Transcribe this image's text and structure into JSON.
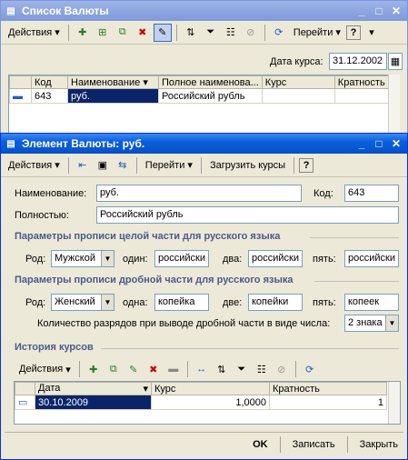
{
  "list_window": {
    "title": "Список Валюты",
    "toolbar": {
      "actions_label": "Действия",
      "goto_label": "Перейти",
      "help_label": "?"
    },
    "rate_date_label": "Дата курса:",
    "rate_date_value": "31.12.2002",
    "columns": [
      "Код",
      "Наименование",
      "Полное наименова...",
      "Курс",
      "Кратность"
    ],
    "rows": [
      {
        "code": "643",
        "name": "руб.",
        "full_name": "Российский рубль",
        "rate": "",
        "multiplicity": ""
      }
    ]
  },
  "element_window": {
    "title": "Элемент Валюты: руб.",
    "toolbar": {
      "actions_label": "Действия",
      "goto_label": "Перейти",
      "load_rates_label": "Загрузить курсы",
      "help_label": "?"
    },
    "name_label": "Наименование:",
    "name_value": "руб.",
    "code_label": "Код:",
    "code_value": "643",
    "full_label": "Полностью:",
    "full_value": "Российский рубль",
    "integer_section": {
      "title": "Параметры прописи целой части для русского языка",
      "gender_label": "Род:",
      "gender_value": "Мужской",
      "one_label": "один:",
      "one_value": "российски",
      "two_label": "два:",
      "two_value": "российски",
      "five_label": "пять:",
      "five_value": "российски"
    },
    "fraction_section": {
      "title": "Параметры прописи дробной части для русского языка",
      "gender_label": "Род:",
      "gender_value": "Женский",
      "one_label": "одна:",
      "one_value": "копейка",
      "two_label": "две:",
      "two_value": "копейки",
      "five_label": "пять:",
      "five_value": "копеек",
      "digits_label": "Количество разрядов при выводе дробной части в виде числа:",
      "digits_value": "2 знака"
    },
    "history": {
      "title": "История курсов",
      "actions_label": "Действия",
      "columns": [
        "Дата",
        "Курс",
        "Кратность"
      ],
      "rows": [
        {
          "date": "30.10.2009",
          "rate": "1,0000",
          "multiplicity": "1"
        }
      ]
    },
    "buttons": {
      "ok": "OK",
      "save": "Записать",
      "close": "Закрыть"
    }
  }
}
